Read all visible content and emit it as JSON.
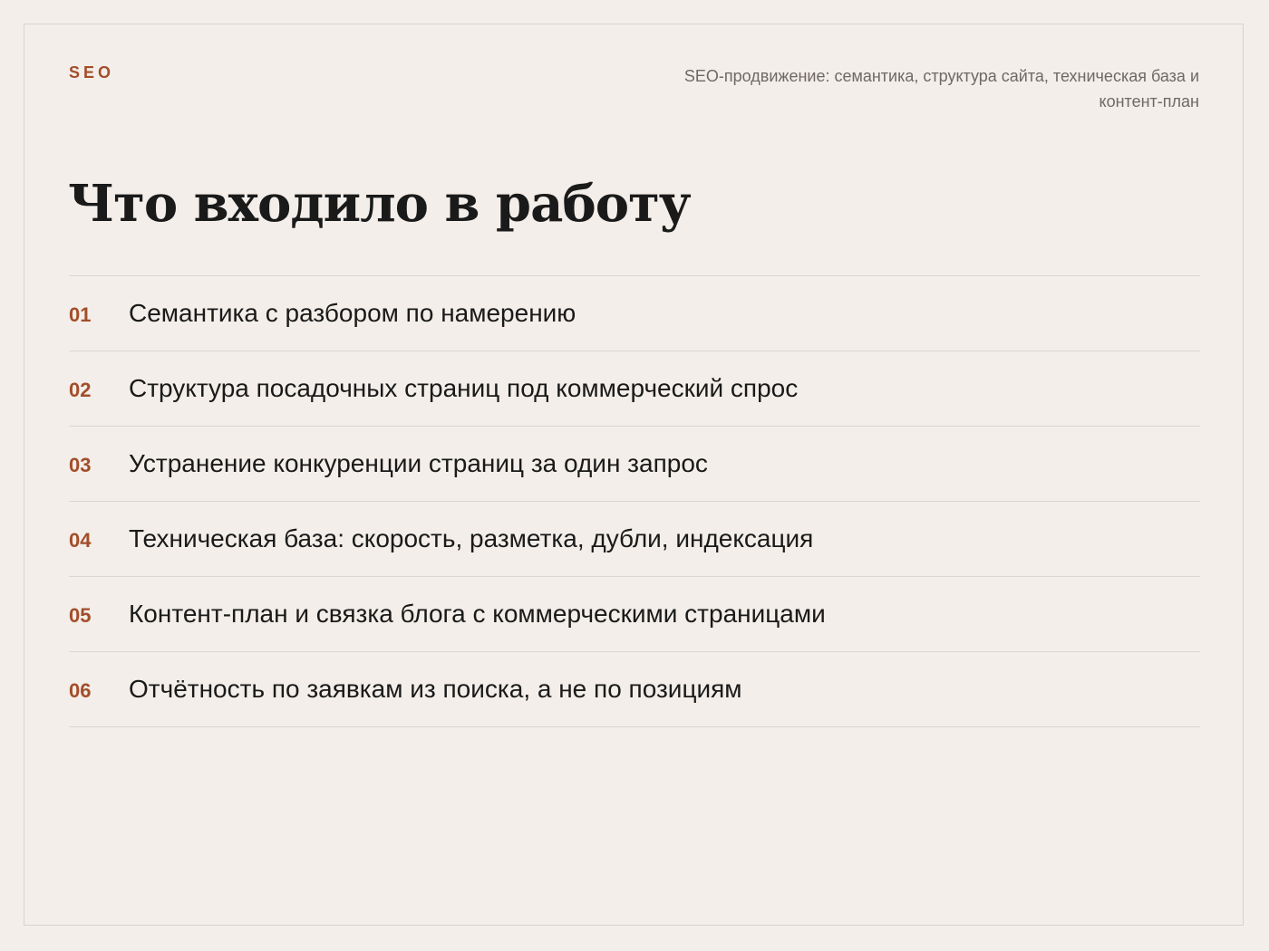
{
  "header": {
    "brand": "SEO",
    "subtitle": "SEO-продвижение: семантика, структура сайта, техническая база и контент-план"
  },
  "title": "Что входило в работу",
  "items": [
    {
      "num": "01",
      "text": "Семантика с разбором по намерению"
    },
    {
      "num": "02",
      "text": "Структура посадочных страниц под коммерческий спрос"
    },
    {
      "num": "03",
      "text": "Устранение конкуренции страниц за один запрос"
    },
    {
      "num": "04",
      "text": "Техническая база: скорость, разметка, дубли, индексация"
    },
    {
      "num": "05",
      "text": "Контент-план и связка блога с коммерческими страницами"
    },
    {
      "num": "06",
      "text": "Отчётность по заявкам из поиска, а не по позициям"
    }
  ],
  "colors": {
    "background": "#f3eee9",
    "accent": "#a34d2a",
    "text": "#1a1a1a",
    "muted": "#6f6964",
    "divider": "#dcd6d0"
  }
}
